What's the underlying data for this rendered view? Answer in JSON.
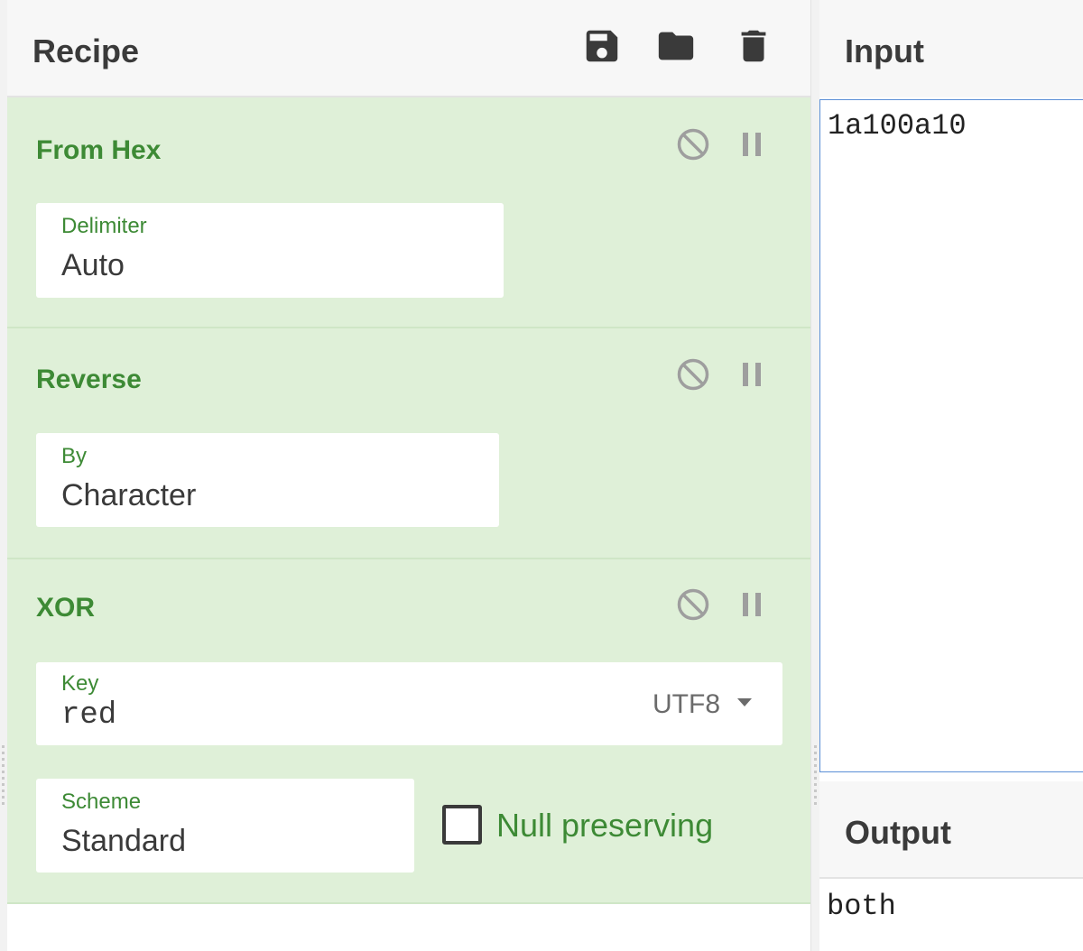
{
  "recipe": {
    "title": "Recipe",
    "toolbar": [
      "save-icon",
      "folder-icon",
      "trash-icon"
    ]
  },
  "operations": [
    {
      "name": "From Hex",
      "args": [
        {
          "label": "Delimiter",
          "value": "Auto"
        }
      ]
    },
    {
      "name": "Reverse",
      "args": [
        {
          "label": "By",
          "value": "Character"
        }
      ]
    },
    {
      "name": "XOR",
      "args": [
        {
          "label": "Key",
          "value": "red",
          "encoding": "UTF8"
        },
        {
          "label": "Scheme",
          "value": "Standard"
        },
        {
          "label": "Null preserving",
          "checked": false
        }
      ]
    }
  ],
  "input": {
    "title": "Input",
    "value": "1a100a10"
  },
  "output": {
    "title": "Output",
    "value": "both"
  },
  "colors": {
    "op_bg": "#dff0d8",
    "op_title": "#3d8a35",
    "focus_border": "#5b8fd6"
  }
}
